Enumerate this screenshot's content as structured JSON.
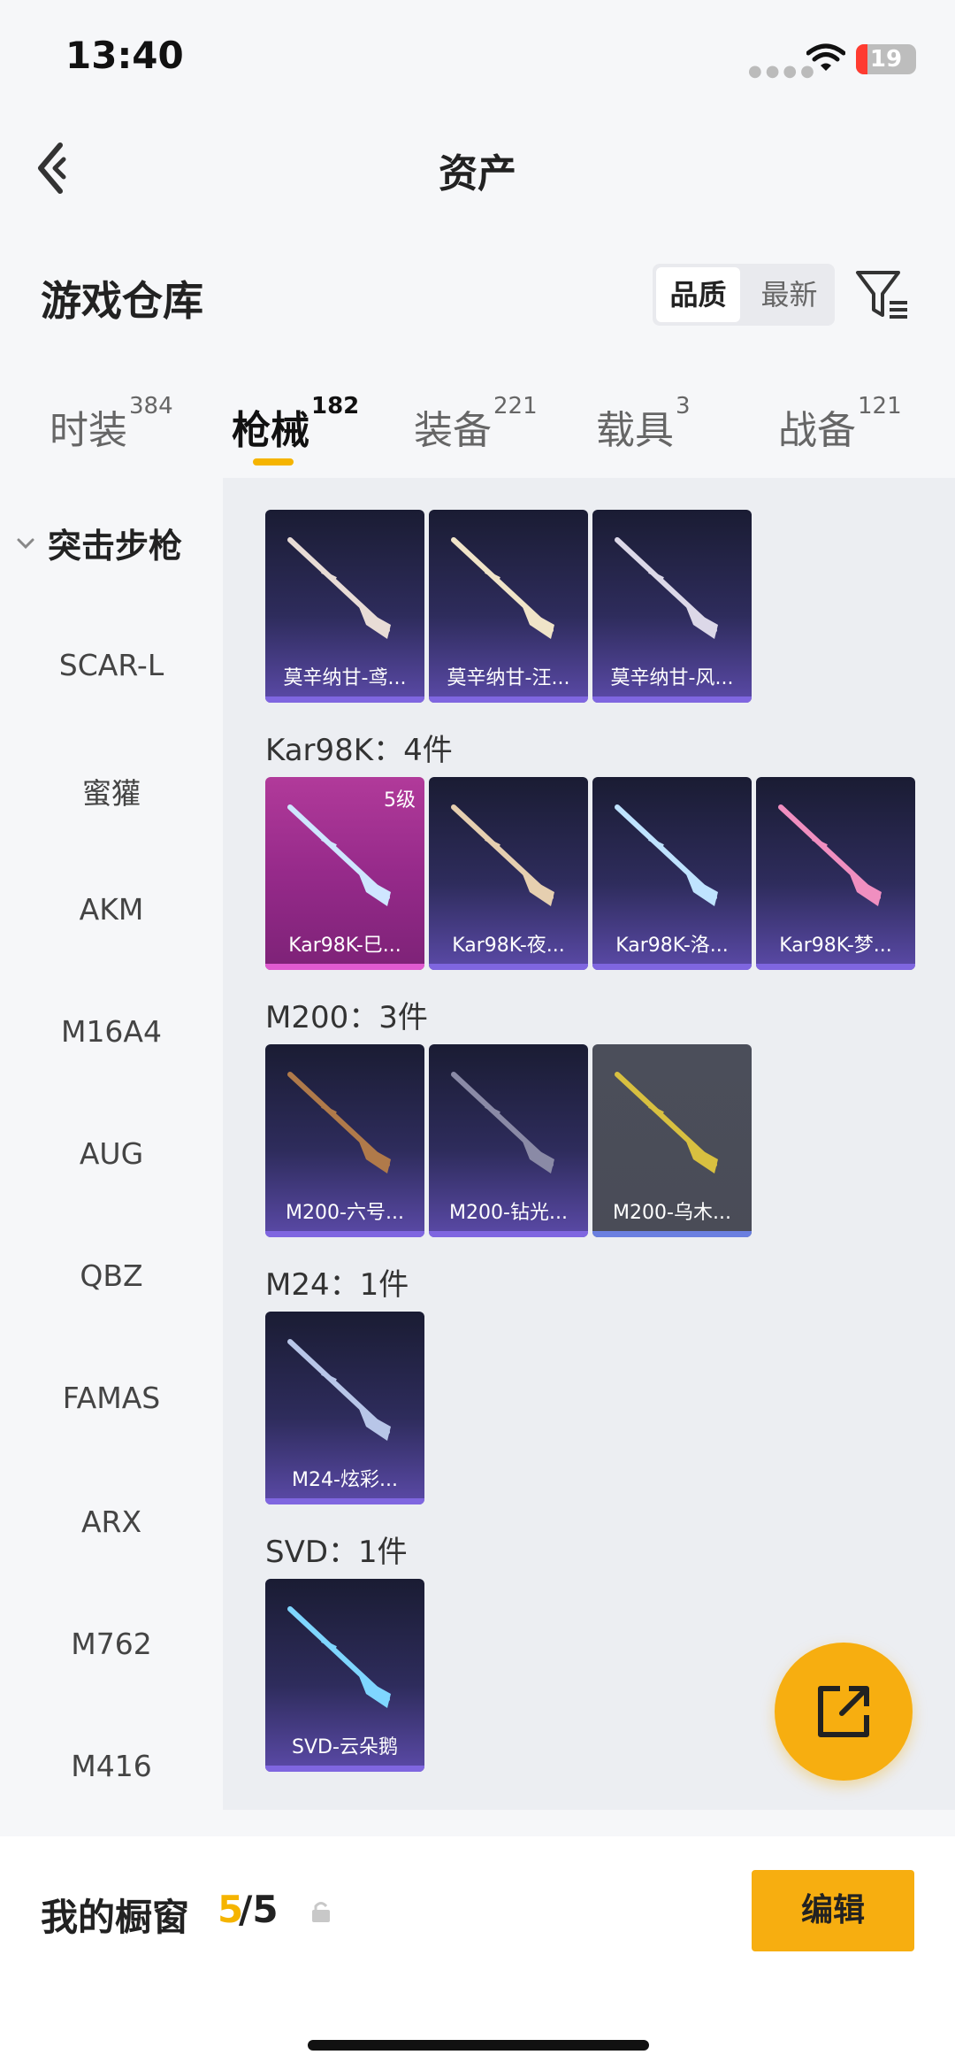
{
  "status_bar": {
    "time": "13:40",
    "battery_level": "19",
    "battery_fraction": 0.19
  },
  "nav": {
    "title": "资产"
  },
  "warehouse": {
    "title": "游戏仓库",
    "sort_options": [
      {
        "label": "品质",
        "active": true
      },
      {
        "label": "最新",
        "active": false
      }
    ]
  },
  "tabs": [
    {
      "label": "时装",
      "count": "384"
    },
    {
      "label": "枪械",
      "count": "182",
      "active": true
    },
    {
      "label": "装备",
      "count": "221"
    },
    {
      "label": "载具",
      "count": "3"
    },
    {
      "label": "战备",
      "count": "121"
    }
  ],
  "sidebar": {
    "group": "突击步枪",
    "items": [
      "SCAR-L",
      "蜜獾",
      "AKM",
      "M16A4",
      "AUG",
      "QBZ",
      "FAMAS",
      "ARX",
      "M762",
      "M416"
    ]
  },
  "content": {
    "groups": [
      {
        "title": "",
        "items": [
          {
            "name": "莫辛纳甘-鸢...",
            "style": "purple",
            "accent": "#e8dcd6"
          },
          {
            "name": "莫辛纳甘-汪...",
            "style": "purple",
            "accent": "#f0e4c8"
          },
          {
            "name": "莫辛纳甘-风...",
            "style": "purple",
            "accent": "#dcd8e8"
          }
        ]
      },
      {
        "title": "Kar98K：4件",
        "items": [
          {
            "name": "Kar98K-巳...",
            "style": "pink",
            "level": "5级",
            "accent": "#cfe6ff"
          },
          {
            "name": "Kar98K-夜...",
            "style": "purple",
            "accent": "#e6cfb0"
          },
          {
            "name": "Kar98K-洛...",
            "style": "purple",
            "accent": "#bfe3ff"
          },
          {
            "name": "Kar98K-梦...",
            "style": "purple",
            "accent": "#f08fc0"
          }
        ]
      },
      {
        "title": "M200：3件",
        "items": [
          {
            "name": "M200-六号...",
            "style": "purple",
            "accent": "#b07a4a"
          },
          {
            "name": "M200-钻光...",
            "style": "purple",
            "accent": "#8a8aa6"
          },
          {
            "name": "M200-乌木...",
            "style": "gray",
            "accent": "#d8c040"
          }
        ]
      },
      {
        "title": "M24：1件",
        "items": [
          {
            "name": "M24-炫彩...",
            "style": "purple",
            "accent": "#b8c6e8"
          }
        ]
      },
      {
        "title": "SVD：1件",
        "items": [
          {
            "name": "SVD-云朵鹅",
            "style": "purple",
            "accent": "#7fd6ff"
          }
        ]
      }
    ]
  },
  "showcase": {
    "label": "我的橱窗",
    "current": "5",
    "total_text": "/5",
    "edit_label": "编辑"
  }
}
